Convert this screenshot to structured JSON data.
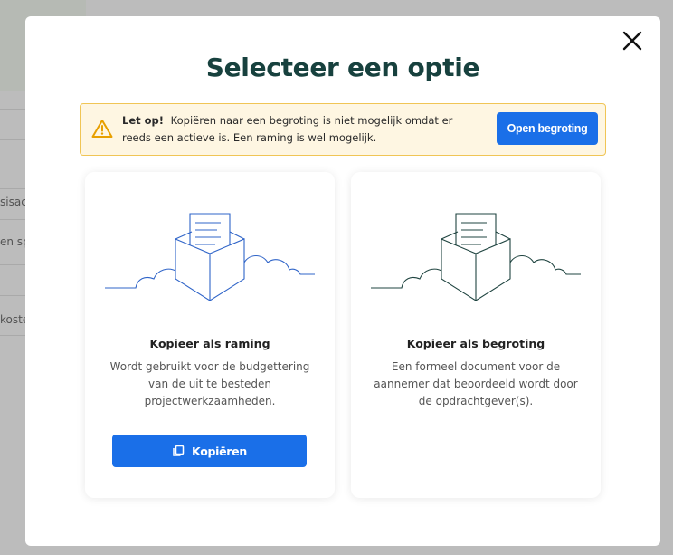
{
  "background": {
    "texts": [
      "sisac",
      "en sp",
      "koste"
    ]
  },
  "modal": {
    "title": "Selecteer een optie",
    "close_icon": "close-icon",
    "alert": {
      "icon": "warning-icon",
      "bold": "Let op!",
      "message": "Kopiëren naar een begroting is niet mogelijk omdat er reeds een actieve is. Een raming is wel mogelijk.",
      "button_label": "Open begroting"
    },
    "options": [
      {
        "title": "Kopieer als raming",
        "description": "Wordt gebruikt voor de budgettering van de uit te besteden projectwerkzaamheden.",
        "button_label": "Kopiëren",
        "button_icon": "copy-icon",
        "illustration_color": "#2f64c8"
      },
      {
        "title": "Kopieer als begroting",
        "description": "Een formeel document voor de aannemer dat beoordeeld wordt door de opdrachtgever(s).",
        "illustration_color": "#1f4440"
      }
    ],
    "colors": {
      "primary": "#1a6fe8",
      "title": "#17413e",
      "warning_bg": "#fef6e2",
      "warning_border": "#f0c555"
    }
  }
}
